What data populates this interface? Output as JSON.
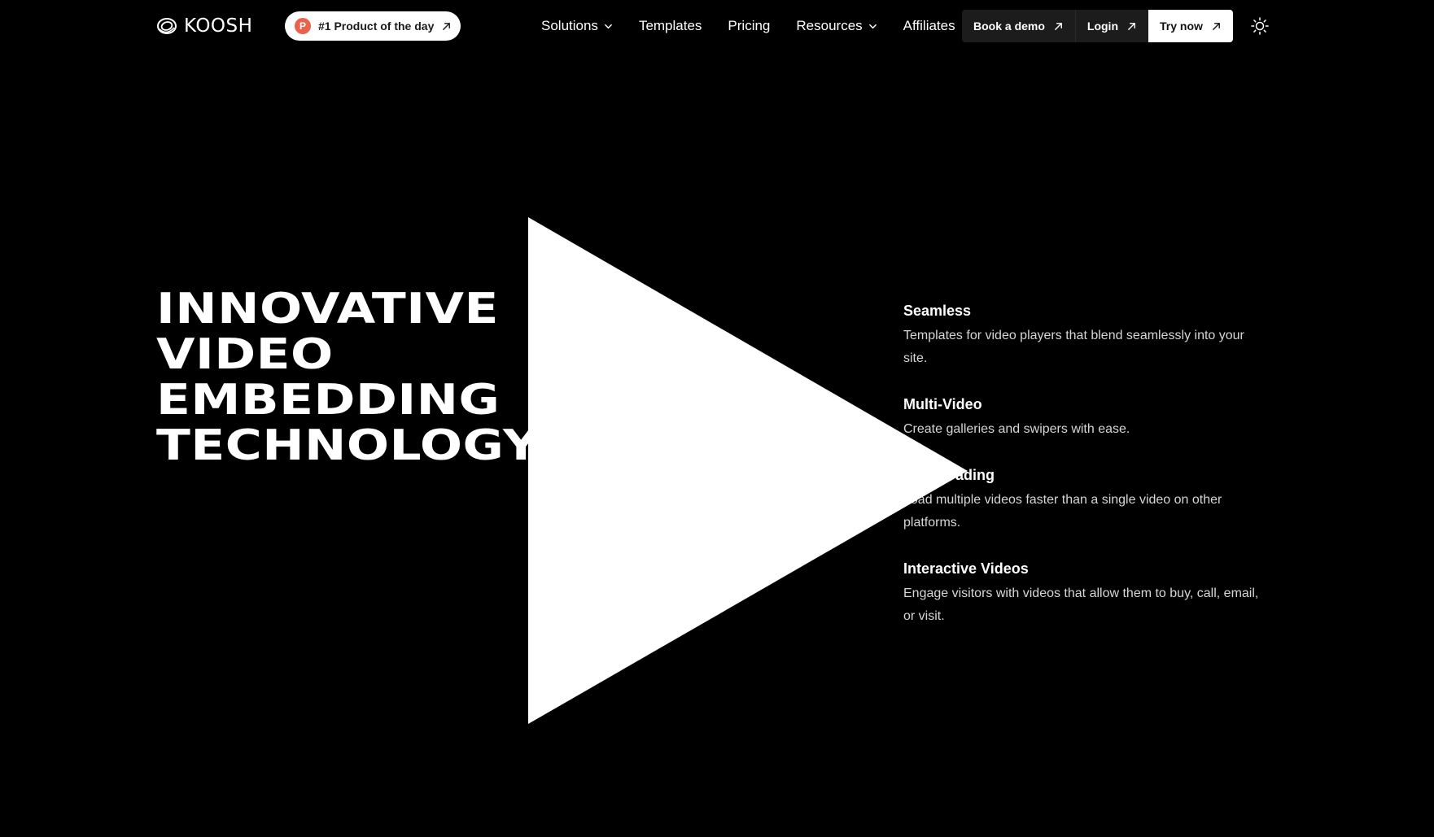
{
  "brand": {
    "name": "KOOSH"
  },
  "badge": {
    "initial": "P",
    "label": "#1 Product of the day"
  },
  "nav": {
    "items": [
      {
        "label": "Solutions",
        "dropdown": true
      },
      {
        "label": "Templates",
        "dropdown": false
      },
      {
        "label": "Pricing",
        "dropdown": false
      },
      {
        "label": "Resources",
        "dropdown": true
      },
      {
        "label": "Affiliates",
        "dropdown": false
      }
    ]
  },
  "buttons": {
    "demo": "Book a demo",
    "login": "Login",
    "try": "Try now"
  },
  "hero": {
    "headline": [
      "INNOVATIVE",
      "VIDEO",
      "EMBEDDING",
      "TECHNOLOGY"
    ]
  },
  "features": [
    {
      "title": "Seamless",
      "desc": "Templates for video players that blend seamlessly into your site."
    },
    {
      "title": "Multi-Video",
      "desc": "Create galleries and swipers with ease."
    },
    {
      "title": "Fast Loading",
      "desc": "Load multiple videos faster than a single video on other platforms."
    },
    {
      "title": "Interactive Videos",
      "desc": "Engage visitors with videos that allow them to buy, call, email, or visit."
    }
  ],
  "icons": {
    "logo": "koosh-logo-icon",
    "external": "arrow-up-right-icon",
    "dropdown": "chevron-down-icon",
    "theme": "sun-icon",
    "play": "play-icon"
  },
  "colors": {
    "background": "#000000",
    "badge_accent": "#e8624c",
    "primary_button": "#ffffff",
    "secondary_button": "#1c1c1c"
  }
}
